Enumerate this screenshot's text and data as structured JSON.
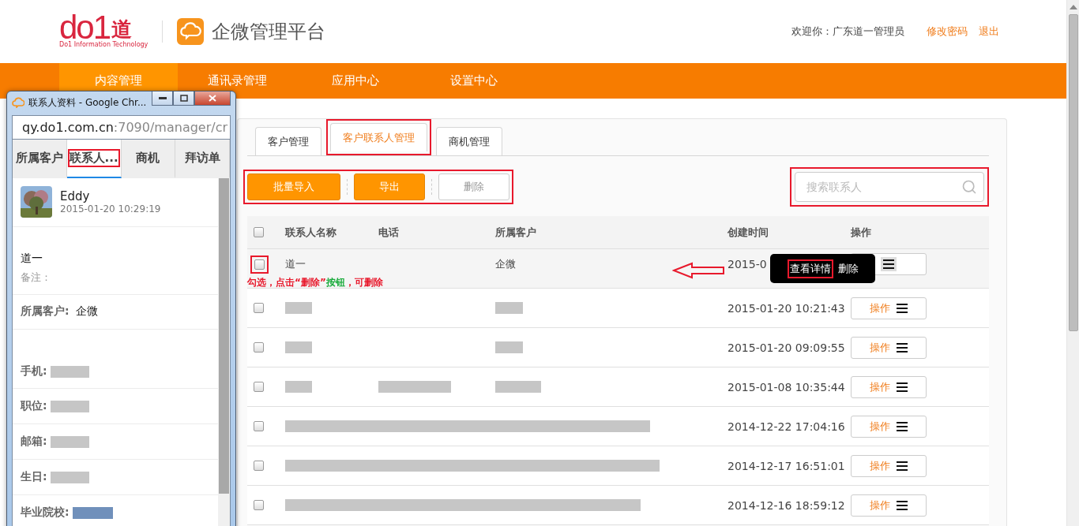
{
  "header": {
    "logo": {
      "mark": "do1",
      "char": "道",
      "tagline": "Do1 Information Technology"
    },
    "app_title": "企微管理平台",
    "welcome": "欢迎你：广东道一管理员",
    "links": [
      "修改密码",
      "退出"
    ]
  },
  "nav": [
    {
      "label": "内容管理",
      "selected": true
    },
    {
      "label": "通讯录管理",
      "selected": false
    },
    {
      "label": "应用中心",
      "selected": false
    },
    {
      "label": "设置中心",
      "selected": false
    }
  ],
  "main": {
    "tabs": [
      {
        "label": "客户管理",
        "selected": false
      },
      {
        "label": "客户联系人管理",
        "selected": true,
        "annotated": true
      },
      {
        "label": "商机管理",
        "selected": false
      }
    ],
    "toolbar": {
      "annotated": true,
      "buttons": [
        {
          "label": "批量导入",
          "kind": "primary"
        },
        {
          "label": "导出",
          "kind": "primary"
        },
        {
          "label": "删除",
          "kind": "plain"
        }
      ]
    },
    "search": {
      "placeholder": "搜索联系人",
      "annotated": true
    },
    "table": {
      "columns": [
        "联系人名称",
        "电话",
        "所属客户",
        "创建时间",
        "操作"
      ],
      "header_checked": false,
      "rows": [
        {
          "kind": "plain",
          "checked": false,
          "annotated": true,
          "name": "道一",
          "customer": "企微",
          "created": "2015-0",
          "note": [
            {
              "text": "勾选，点击",
              "color": "#e8192c"
            },
            {
              "text": "“删除”",
              "color": "#e8192c"
            },
            {
              "text": "按钮",
              "color": "#1aab3c"
            },
            {
              "text": "，可删除",
              "color": "#e8192c"
            }
          ],
          "menu": [
            {
              "label": "查看详情",
              "annotated": true
            },
            {
              "label": "删除"
            }
          ]
        },
        {
          "kind": "redacted",
          "checked": false,
          "created": "2015-01-20 10:21:43",
          "action": "操作"
        },
        {
          "kind": "redacted",
          "checked": false,
          "created": "2015-01-20 09:09:55",
          "action": "操作"
        },
        {
          "kind": "redacted",
          "checked": false,
          "phone_redacted": true,
          "created": "2015-01-08 10:35:44",
          "action": "操作"
        },
        {
          "kind": "redacted_span",
          "checked": false,
          "created": "2014-12-22 17:04:16",
          "action": "操作"
        },
        {
          "kind": "redacted_span",
          "checked": false,
          "created": "2014-12-17 16:51:01",
          "action": "操作"
        },
        {
          "kind": "redacted_span",
          "checked": false,
          "created": "2014-12-16 18:59:12",
          "action": "操作"
        }
      ]
    }
  },
  "popup": {
    "title": "联系人资料 - Google Chr...",
    "url_host": "qy.do1.com.cn",
    "url_rest": ":7090/manager/cr",
    "tabs": [
      {
        "label": "所属客户",
        "selected": false
      },
      {
        "label": "联系人...",
        "selected": true,
        "annotated": true
      },
      {
        "label": "商机",
        "selected": false
      },
      {
        "label": "拜访单",
        "selected": false
      }
    ],
    "contact": {
      "name": "Eddy",
      "time": "2015-01-20 10:29:19"
    },
    "display_name": "道一",
    "remark_label": "备注：",
    "customer": {
      "label": "所属客户:",
      "value": "企微"
    },
    "fields": [
      {
        "label": "手机:",
        "kind": "redacted"
      },
      {
        "label": "职位:",
        "kind": "redacted"
      },
      {
        "label": "邮箱:",
        "kind": "redacted"
      },
      {
        "label": "生日:",
        "kind": "redacted"
      },
      {
        "label": "毕业院校:",
        "kind": "highlighted"
      }
    ]
  }
}
